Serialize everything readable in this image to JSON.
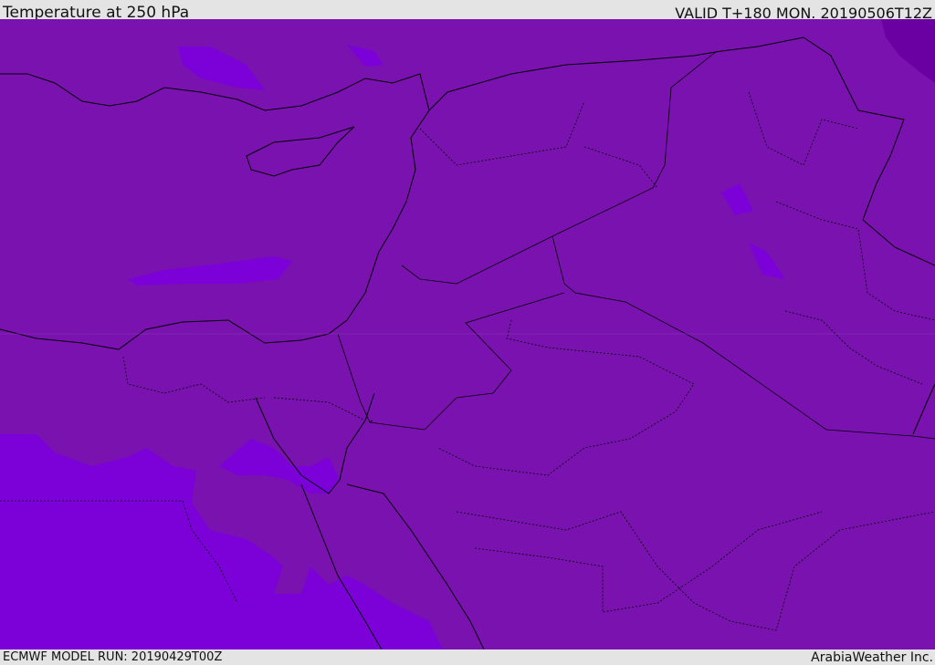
{
  "header": {
    "title": "Temperature at 250 hPa",
    "valid": "VALID T+180 MON. 20190506T12Z"
  },
  "footer": {
    "model_run": "ECMWF MODEL RUN: 20190429T00Z",
    "credit": "ArabiaWeather Inc."
  },
  "colors": {
    "base": "#7a12b0",
    "warm": "#7c00d8",
    "cold": "#6a00a2",
    "coast": "#000000"
  }
}
